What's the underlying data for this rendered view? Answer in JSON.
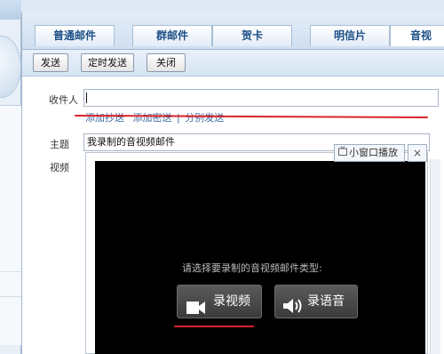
{
  "tabs": [
    {
      "label": "普通邮件"
    },
    {
      "label": "群邮件"
    },
    {
      "label": "贺卡"
    },
    {
      "label": "明信片"
    },
    {
      "label": "音视"
    }
  ],
  "toolbar": {
    "send_label": "发送",
    "scheduled_send_label": "定时发送",
    "close_label": "关闭"
  },
  "form": {
    "to_label": "收件人",
    "to_value": "",
    "links": {
      "add_cc": "添加抄送",
      "add_bcc": "添加密送",
      "separator": "|",
      "separate_send": "分别发送"
    },
    "subject_label": "主题",
    "subject_value": "我录制的音视频邮件",
    "video_label": "视频"
  },
  "player": {
    "popout_label": "小窗口播放",
    "close_symbol": "×",
    "hint": "请选择要录制的音视频邮件类型:",
    "record_video_label": "录视频",
    "record_audio_label": "录语音"
  },
  "colors": {
    "tab_text": "#1d4f86",
    "annotation_red": "#d9242a",
    "link": "#3f6aa0"
  }
}
